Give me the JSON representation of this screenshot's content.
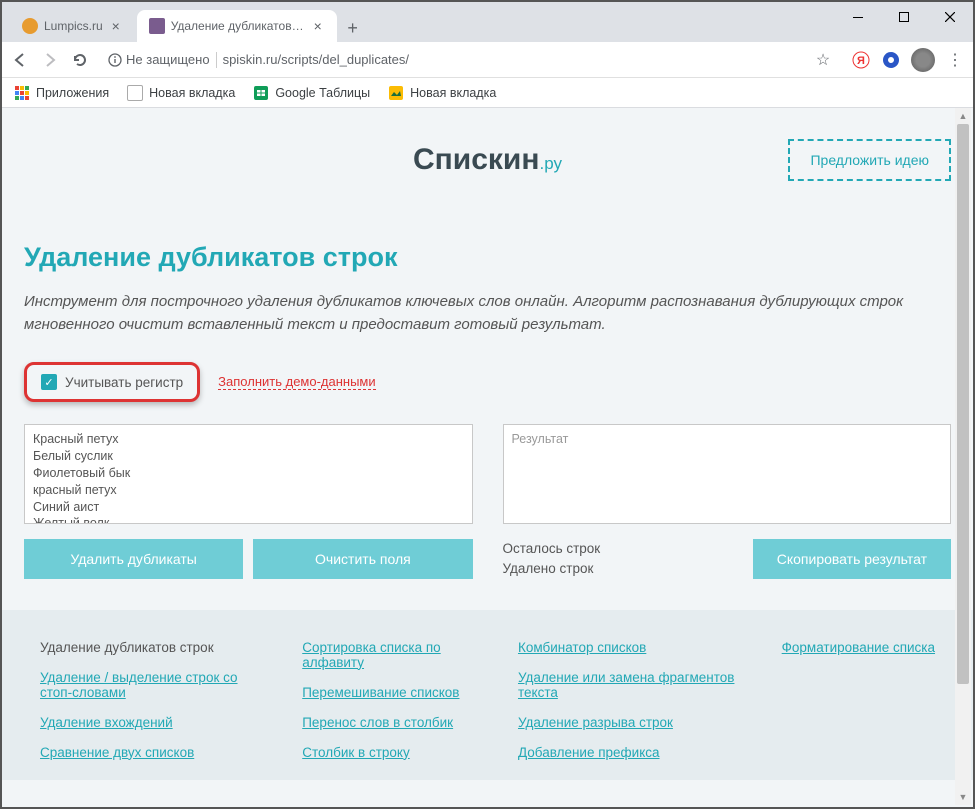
{
  "window": {
    "tab1": "Lumpics.ru",
    "tab2": "Удаление дубликатов строк - у..."
  },
  "addr": {
    "security": "Не защищено",
    "url": "spiskin.ru/scripts/del_duplicates/"
  },
  "bookmarks": {
    "apps": "Приложения",
    "newTab1": "Новая вкладка",
    "gsheets": "Google Таблицы",
    "newTab2": "Новая вкладка"
  },
  "site": {
    "logo": "Спискин",
    "suffix": ".ру",
    "suggest": "Предложить идею"
  },
  "page": {
    "title": "Удаление дубликатов строк",
    "desc": "Инструмент для построчного удаления дубликатов ключевых слов онлайн. Алгоритм распознавания дублирующих строк мгновенного очистит вставленный текст и предоставит готовый результат.",
    "caseLabel": "Учитывать регистр",
    "demoFill": "Заполнить демо-данными"
  },
  "input": {
    "text": "Красный петух\nБелый суслик\nФиолетовый бык\nкрасный петух\nСиний аист\nЖелтый волк\nОранжевый медведь\nСиний аист",
    "removeBtn": "Удалить дубликаты",
    "clearBtn": "Очистить поля"
  },
  "output": {
    "placeholder": "Результат",
    "statsLines": "Осталось строк",
    "statsRemoved": "Удалено строк",
    "copyBtn": "Скопировать результат"
  },
  "footer": {
    "col1": [
      "Удаление дубликатов строк",
      "Удаление / выделение строк со стоп-словами",
      "Удаление вхождений",
      "Сравнение двух списков"
    ],
    "col2": [
      "Сортировка списка по алфавиту",
      "Перемешивание списков",
      "Перенос слов в столбик",
      "Столбик в строку"
    ],
    "col3": [
      "Комбинатор списков",
      "Удаление или замена фрагментов текста",
      "Удаление разрыва строк",
      "Добавление префикса"
    ],
    "col4": [
      "Форматирование списка"
    ]
  }
}
